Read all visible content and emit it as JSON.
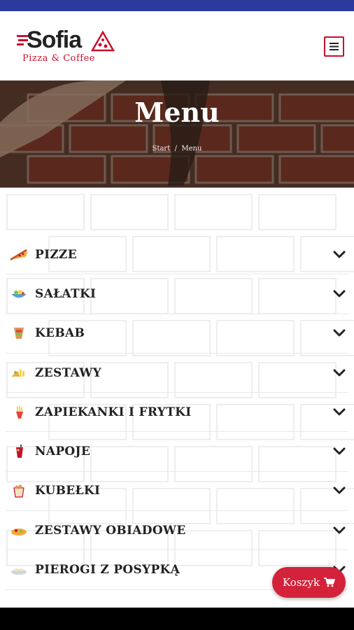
{
  "header": {
    "logo_brand": "Sofia",
    "logo_tagline": "Pizza & Coffee",
    "menu_icon": "hamburger-icon"
  },
  "hero": {
    "title": "Menu",
    "breadcrumb": {
      "home": "Start",
      "separator": "/",
      "current": "Menu"
    }
  },
  "categories": [
    {
      "label": "PIZZE",
      "icon": "pizza-icon"
    },
    {
      "label": "SAŁATKI",
      "icon": "salad-icon"
    },
    {
      "label": "KEBAB",
      "icon": "kebab-icon"
    },
    {
      "label": "ZESTAWY",
      "icon": "set-icon"
    },
    {
      "label": "ZAPIEKANKI I FRYTKI",
      "icon": "fries-icon"
    },
    {
      "label": "NAPOJE",
      "icon": "drink-icon"
    },
    {
      "label": "KUBEŁKI",
      "icon": "bucket-icon"
    },
    {
      "label": "ZESTAWY OBIADOWE",
      "icon": "dinner-icon"
    },
    {
      "label": "PIEROGI Z POSYPKĄ",
      "icon": "dumplings-icon"
    }
  ],
  "cart": {
    "label": "Koszyk",
    "icon": "cart-icon"
  },
  "colors": {
    "accent": "#d3223a",
    "status_bar": "#2c3a9e",
    "text": "#222222"
  }
}
